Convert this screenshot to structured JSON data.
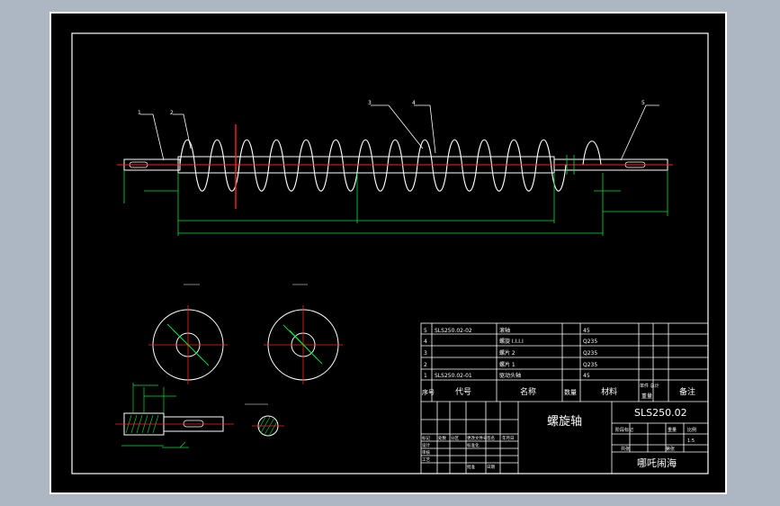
{
  "drawing": {
    "part_callouts": [
      "1",
      "2",
      "3",
      "4",
      "5"
    ],
    "title_block": {
      "drawing_number": "SLS250.02",
      "part_name": "螺旋轴",
      "designer": "哪吒闹海",
      "scale": "1:5",
      "headers": {
        "seq": "序号",
        "code": "代号",
        "name": "名称",
        "qty": "数量",
        "material": "材料",
        "unit_total": "单件 总计",
        "weight": "重量",
        "remark": "备注"
      },
      "bom": [
        {
          "seq": "5",
          "code": "SLS250.02-02",
          "name": "滚轴",
          "material": "45"
        },
        {
          "seq": "4",
          "code": "",
          "name": "螺旋 Ⅰ.Ⅰ.Ⅰ.Ⅰ",
          "material": "Q235"
        },
        {
          "seq": "3",
          "code": "",
          "name": "螺片 2",
          "material": "Q235"
        },
        {
          "seq": "2",
          "code": "",
          "name": "螺片 1",
          "material": "Q235"
        },
        {
          "seq": "1",
          "code": "SLS250.02-01",
          "name": "驱动头轴",
          "material": "45"
        }
      ],
      "sign_labels": [
        "标记",
        "处数",
        "分区",
        "更改文件号",
        "签名",
        "年月日",
        "设计",
        "审核",
        "工艺",
        "日期",
        "标准化",
        "批准"
      ],
      "stage_labels": [
        "阶段标记",
        "重量",
        "比例",
        "共张",
        "第张"
      ]
    }
  }
}
